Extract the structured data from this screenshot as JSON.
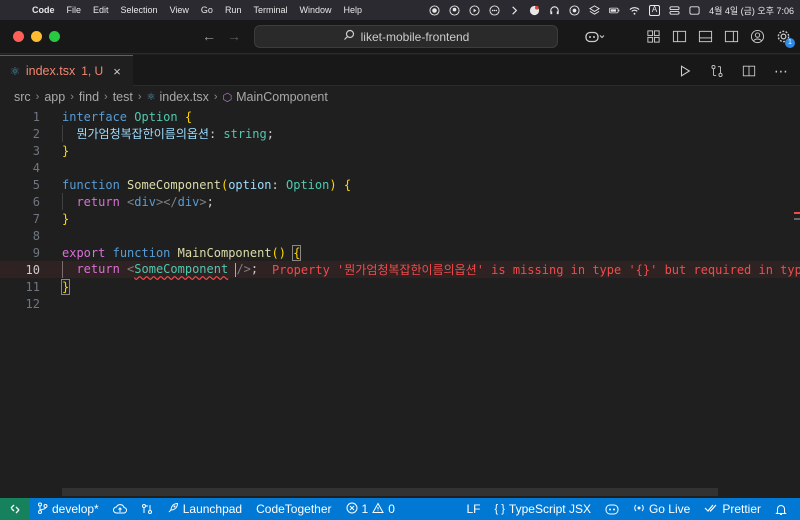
{
  "menubar": {
    "app": "Code",
    "items": [
      "File",
      "Edit",
      "Selection",
      "View",
      "Go",
      "Run",
      "Terminal",
      "Window",
      "Help"
    ],
    "input_source": "A",
    "clock": "4월 4일 (금) 오후 7:06"
  },
  "titlebar": {
    "search_text": "liket-mobile-frontend",
    "account_badge": "1"
  },
  "tab": {
    "title": "index.tsx",
    "status": "1, U",
    "close": "×",
    "file_icon": "TS"
  },
  "breadcrumb": {
    "parts": [
      "src",
      "app",
      "find",
      "test",
      "index.tsx",
      "MainComponent"
    ]
  },
  "editor": {
    "line_numbers": [
      "1",
      "2",
      "3",
      "4",
      "5",
      "6",
      "7",
      "8",
      "9",
      "10",
      "11",
      "12"
    ],
    "active_line": "10",
    "error_message": "Property '뭔가엄청복잡한이름의옵션' is missing in type '{}' but required in type 'Op",
    "tokens": {
      "interface": "interface",
      "option": "Option",
      "prop": "뭔가엄청복잡한이름의옵션",
      "string": "string",
      "function": "function",
      "some_component": "SomeComponent",
      "param": "option",
      "return": "return",
      "div_tag": "div",
      "export": "export",
      "main_component": "MainComponent"
    }
  },
  "statusbar": {
    "branch": "develop*",
    "launchpad": "Launchpad",
    "codetogether": "CodeTogether",
    "errors": "1",
    "warnings": "0",
    "eol": "LF",
    "language": "TypeScript JSX",
    "golive": "Go Live",
    "prettier": "Prettier"
  },
  "colors": {
    "accent": "#0078d4",
    "error": "#f14c4c",
    "remote": "#16825d"
  }
}
